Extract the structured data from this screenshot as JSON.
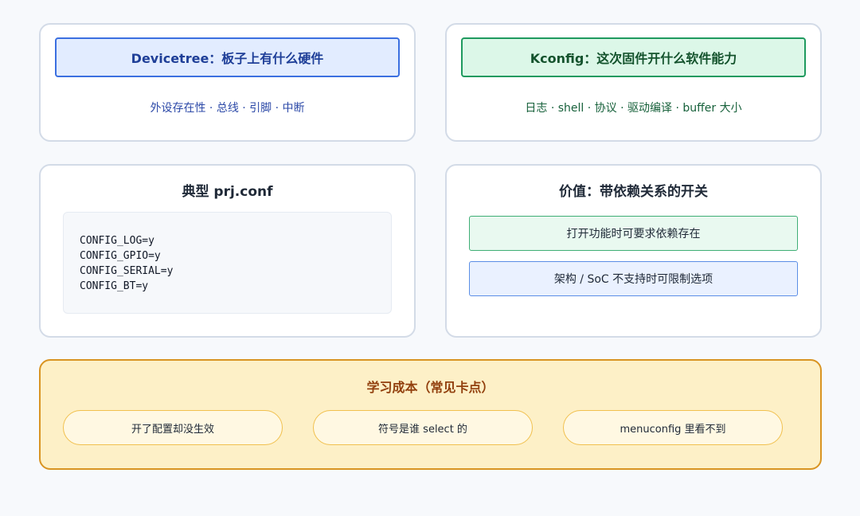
{
  "devicetree": {
    "title": "Devicetree：板子上有什么硬件",
    "subtitle": "外设存在性 · 总线 · 引脚 · 中断"
  },
  "kconfig": {
    "title": "Kconfig：这次固件开什么软件能力",
    "subtitle": "日志 · shell · 协议 · 驱动编译 · buffer 大小"
  },
  "prjconf": {
    "title": "典型 prj.conf",
    "lines": [
      "CONFIG_LOG=y",
      "CONFIG_GPIO=y",
      "CONFIG_SERIAL=y",
      "CONFIG_BT=y"
    ]
  },
  "value": {
    "title": "价值：带依赖关系的开关",
    "items": [
      "打开功能时可要求依赖存在",
      "架构 / SoC 不支持时可限制选项"
    ]
  },
  "cost": {
    "title": "学习成本（常见卡点）",
    "items": [
      "开了配置却没生效",
      "符号是谁 select 的",
      "menuconfig 里看不到"
    ]
  },
  "colors": {
    "dt_border": "#3b6fe0",
    "dt_fill": "#e2ecff",
    "dt_text": "#1f3f98",
    "dt_sub": "#2d4aa8",
    "kc_border": "#1f9a5f",
    "kc_fill": "#dcf7e8",
    "kc_text": "#14532d",
    "kc_sub": "#16603a",
    "cost_border": "#d99422",
    "cost_fill": "#fdf0c7",
    "cost_title": "#92400e"
  }
}
